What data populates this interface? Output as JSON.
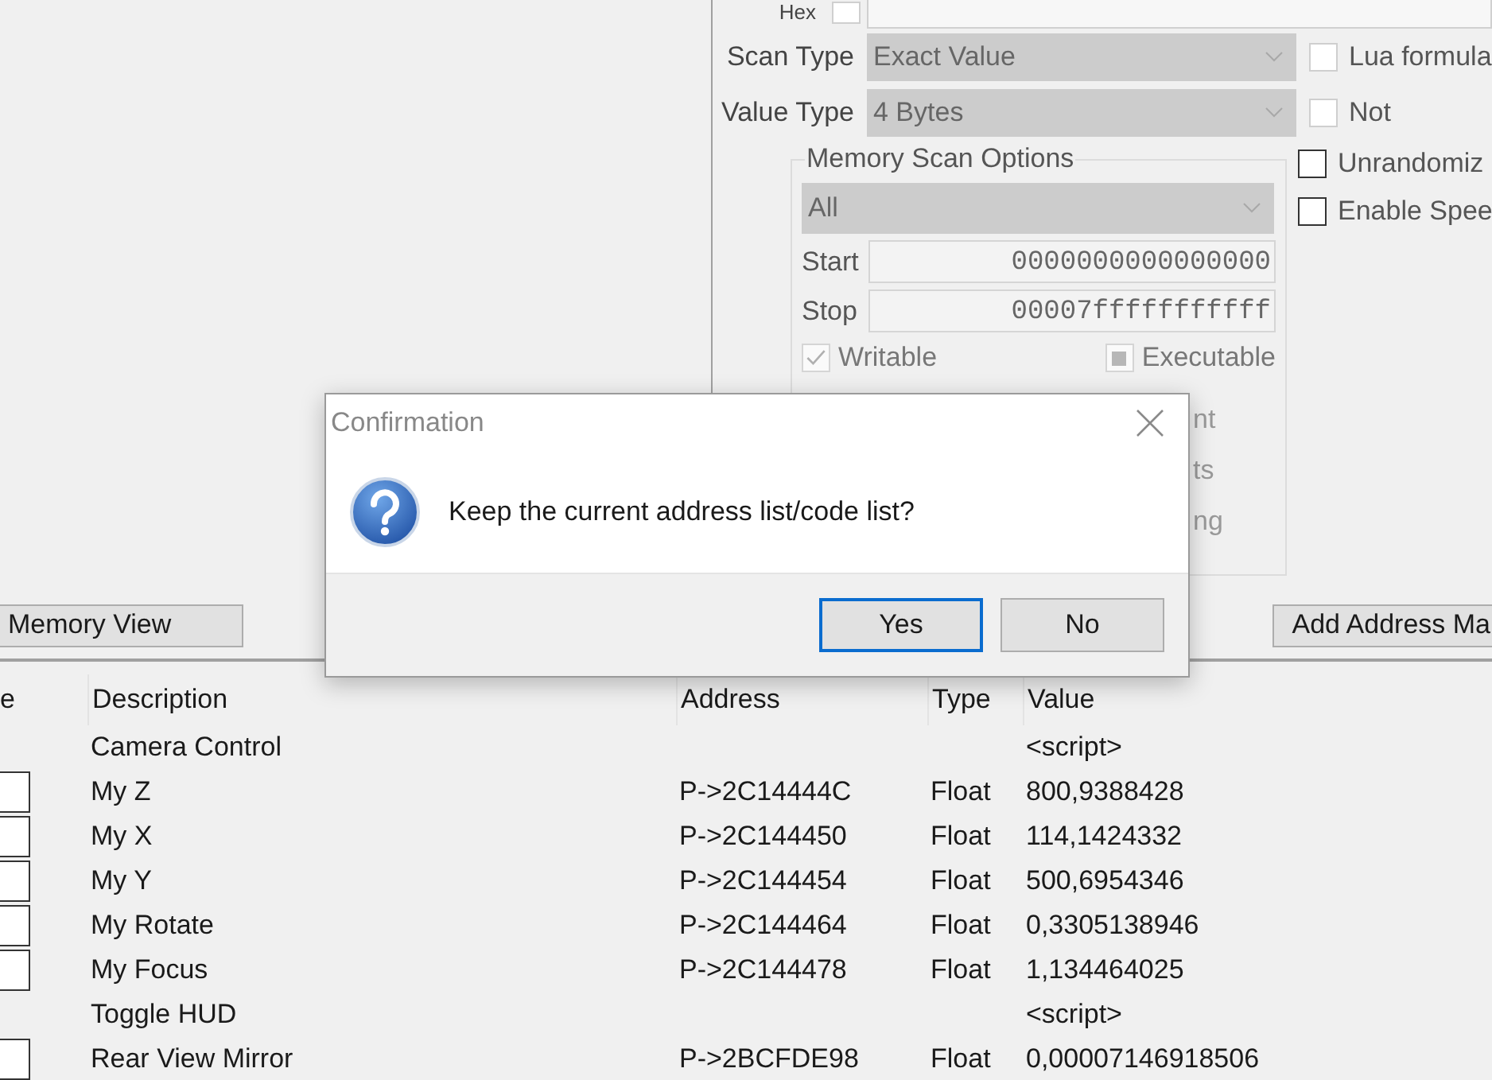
{
  "scan_panel": {
    "hex": {
      "label": "Hex",
      "checked": false
    },
    "scan_type": {
      "label": "Scan Type",
      "value": "Exact Value"
    },
    "value_type": {
      "label": "Value Type",
      "value": "4 Bytes"
    },
    "side_options": [
      {
        "label": "Lua formula",
        "checked": false
      },
      {
        "label": "Not",
        "checked": false
      },
      {
        "label": "Unrandomiz",
        "checked": false
      },
      {
        "label": "Enable Spee",
        "checked": false
      }
    ],
    "memory_scan_options": {
      "title": "Memory Scan Options",
      "region": "All",
      "start": {
        "label": "Start",
        "value": "0000000000000000"
      },
      "stop": {
        "label": "Stop",
        "value": "00007fffffffffff"
      },
      "flags": [
        {
          "label": "Writable",
          "checked": true
        },
        {
          "label": "Executable",
          "indeterminate": true
        }
      ],
      "hidden_fragments": [
        "nt",
        "ts",
        "ng"
      ]
    }
  },
  "buttons": [
    {
      "label": "Memory View"
    },
    {
      "label": "Add Address Ma"
    }
  ],
  "table": {
    "columns": [
      "e",
      "Description",
      "Address",
      "Type",
      "Value"
    ],
    "rows": [
      {
        "kind": "group",
        "description": "Camera Control",
        "address": "",
        "type": "",
        "value": "<script>"
      },
      {
        "kind": "entry",
        "checked": false,
        "description": "My Z",
        "address": "P->2C14444C",
        "type": "Float",
        "value": "800,9388428"
      },
      {
        "kind": "entry",
        "checked": false,
        "description": "My X",
        "address": "P->2C144450",
        "type": "Float",
        "value": "114,1424332"
      },
      {
        "kind": "entry",
        "checked": false,
        "description": "My Y",
        "address": "P->2C144454",
        "type": "Float",
        "value": "500,6954346"
      },
      {
        "kind": "entry",
        "checked": false,
        "description": "My Rotate",
        "address": "P->2C144464",
        "type": "Float",
        "value": "0,3305138946"
      },
      {
        "kind": "entry",
        "checked": false,
        "description": "My Focus",
        "address": "P->2C144478",
        "type": "Float",
        "value": "1,134464025"
      },
      {
        "kind": "group",
        "description": "Toggle HUD",
        "address": "",
        "type": "",
        "value": "<script>"
      },
      {
        "kind": "entry",
        "checked": false,
        "description": "Rear View Mirror",
        "address": "P->2BCFDE98",
        "type": "Float",
        "value": "0,00007146918506"
      }
    ]
  },
  "dialog": {
    "title": "Confirmation",
    "message": "Keep the current address list/code list?",
    "buttons": [
      {
        "label": "Yes",
        "selected": true
      },
      {
        "label": "No",
        "selected": false
      }
    ]
  }
}
